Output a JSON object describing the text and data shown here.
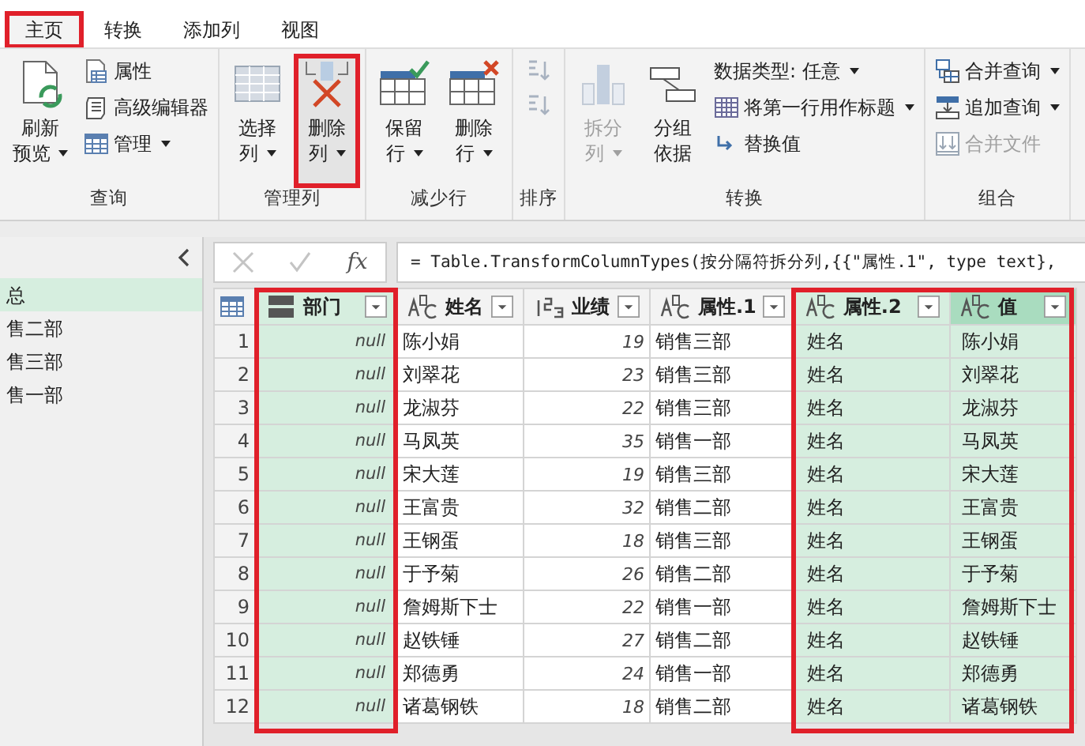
{
  "ribbon_tabs": [
    {
      "label": "主页",
      "selected": true,
      "highlighted": true
    },
    {
      "label": "转换",
      "selected": false,
      "highlighted": false
    },
    {
      "label": "添加列",
      "selected": false,
      "highlighted": false
    },
    {
      "label": "视图",
      "selected": false,
      "highlighted": false
    }
  ],
  "ribbon_groups": [
    {
      "label": "查询",
      "items": [
        {
          "kind": "large",
          "lines": [
            "刷新",
            "预览"
          ],
          "dropdown": true,
          "disabled": false,
          "highlighted": false
        },
        {
          "kind": "small",
          "lines": [
            "属性"
          ],
          "dropdown": false,
          "disabled": false,
          "highlighted": false
        },
        {
          "kind": "small",
          "lines": [
            "高级编辑器"
          ],
          "dropdown": false,
          "disabled": false,
          "highlighted": false
        },
        {
          "kind": "small",
          "lines": [
            "管理"
          ],
          "dropdown": true,
          "disabled": false,
          "highlighted": false
        }
      ]
    },
    {
      "label": "管理列",
      "items": [
        {
          "kind": "large",
          "lines": [
            "选择",
            "列"
          ],
          "dropdown": true,
          "disabled": false,
          "highlighted": false
        },
        {
          "kind": "large",
          "lines": [
            "删除",
            "列"
          ],
          "dropdown": true,
          "disabled": false,
          "highlighted": true
        }
      ]
    },
    {
      "label": "减少行",
      "items": [
        {
          "kind": "large",
          "lines": [
            "保留",
            "行"
          ],
          "dropdown": true,
          "disabled": false,
          "highlighted": false
        },
        {
          "kind": "large",
          "lines": [
            "删除",
            "行"
          ],
          "dropdown": true,
          "disabled": false,
          "highlighted": false
        }
      ]
    },
    {
      "label": "排序",
      "items": [
        {
          "kind": "icon",
          "disabled": true
        },
        {
          "kind": "icon",
          "disabled": true
        }
      ]
    },
    {
      "label": "转换",
      "items": [
        {
          "kind": "large",
          "lines": [
            "拆分",
            "列"
          ],
          "dropdown": true,
          "disabled": true,
          "highlighted": false
        },
        {
          "kind": "large",
          "lines": [
            "分组",
            "依据"
          ],
          "dropdown": false,
          "disabled": false,
          "highlighted": false
        },
        {
          "kind": "small",
          "lines": [
            "数据类型: 任意"
          ],
          "dropdown": true,
          "disabled": false,
          "highlighted": false
        },
        {
          "kind": "small",
          "lines": [
            "将第一行用作标题"
          ],
          "dropdown": true,
          "disabled": false,
          "highlighted": false
        },
        {
          "kind": "small",
          "lines": [
            "替换值"
          ],
          "dropdown": false,
          "disabled": false,
          "highlighted": false
        }
      ]
    },
    {
      "label": "组合",
      "items": [
        {
          "kind": "small",
          "lines": [
            "合并查询"
          ],
          "dropdown": true,
          "disabled": false,
          "highlighted": false
        },
        {
          "kind": "small",
          "lines": [
            "追加查询"
          ],
          "dropdown": true,
          "disabled": false,
          "highlighted": false
        },
        {
          "kind": "small",
          "lines": [
            "合并文件"
          ],
          "dropdown": false,
          "disabled": true,
          "highlighted": false
        }
      ]
    }
  ],
  "queries": [
    {
      "label": "总",
      "selected": true
    },
    {
      "label": "售二部",
      "selected": false
    },
    {
      "label": "售三部",
      "selected": false
    },
    {
      "label": "售一部",
      "selected": false
    }
  ],
  "formula_bar": {
    "fx_label": "fx",
    "formula": "= Table.TransformColumnTypes(按分隔符拆分列,{{\"属性.1\", type text},"
  },
  "table": {
    "columns": [
      {
        "name": "部门",
        "kind": "any",
        "selected": true,
        "active": false,
        "highlighted": true
      },
      {
        "name": "姓名",
        "kind": "text",
        "selected": false,
        "active": false,
        "highlighted": false
      },
      {
        "name": "业绩",
        "kind": "number",
        "selected": false,
        "active": false,
        "highlighted": false
      },
      {
        "name": "属性.1",
        "kind": "text",
        "selected": false,
        "active": false,
        "highlighted": false
      },
      {
        "name": "属性.2",
        "kind": "text",
        "selected": true,
        "active": false,
        "highlighted": true
      },
      {
        "name": "值",
        "kind": "text",
        "selected": true,
        "active": true,
        "highlighted": true
      }
    ],
    "rows": [
      {
        "number": "1",
        "cells": [
          "null",
          "陈小娟",
          "19",
          "销售三部",
          "姓名",
          "陈小娟"
        ]
      },
      {
        "number": "2",
        "cells": [
          "null",
          "刘翠花",
          "23",
          "销售三部",
          "姓名",
          "刘翠花"
        ]
      },
      {
        "number": "3",
        "cells": [
          "null",
          "龙淑芬",
          "22",
          "销售三部",
          "姓名",
          "龙淑芬"
        ]
      },
      {
        "number": "4",
        "cells": [
          "null",
          "马凤英",
          "35",
          "销售一部",
          "姓名",
          "马凤英"
        ]
      },
      {
        "number": "5",
        "cells": [
          "null",
          "宋大莲",
          "19",
          "销售三部",
          "姓名",
          "宋大莲"
        ]
      },
      {
        "number": "6",
        "cells": [
          "null",
          "王富贵",
          "32",
          "销售二部",
          "姓名",
          "王富贵"
        ]
      },
      {
        "number": "7",
        "cells": [
          "null",
          "王钢蛋",
          "18",
          "销售三部",
          "姓名",
          "王钢蛋"
        ]
      },
      {
        "number": "8",
        "cells": [
          "null",
          "于予菊",
          "26",
          "销售二部",
          "姓名",
          "于予菊"
        ]
      },
      {
        "number": "9",
        "cells": [
          "null",
          "詹姆斯下士",
          "22",
          "销售一部",
          "姓名",
          "詹姆斯下士"
        ]
      },
      {
        "number": "10",
        "cells": [
          "null",
          "赵铁锤",
          "27",
          "销售二部",
          "姓名",
          "赵铁锤"
        ]
      },
      {
        "number": "11",
        "cells": [
          "null",
          "郑德勇",
          "24",
          "销售一部",
          "姓名",
          "郑德勇"
        ]
      },
      {
        "number": "12",
        "cells": [
          "null",
          "诸葛钢铁",
          "18",
          "销售二部",
          "姓名",
          "诸葛钢铁"
        ]
      }
    ]
  }
}
